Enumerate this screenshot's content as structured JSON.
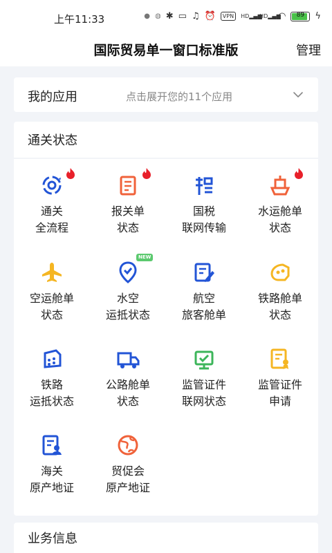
{
  "status_bar": {
    "time": "上午11:33",
    "vpn": "VPN",
    "network_1": "HD",
    "network_2": "HD",
    "battery": 89
  },
  "header": {
    "title": "国际贸易单一窗口标准版",
    "manage": "管理"
  },
  "my_apps": {
    "title": "我的应用",
    "hint": "点击展开您的11个应用"
  },
  "customs_status": {
    "title": "通关状态",
    "badge_new": "NEW",
    "items": [
      {
        "line1": "通关",
        "line2": "全流程",
        "icon": "clearance-cycle-icon",
        "color": "#2254d6",
        "badge": "fire"
      },
      {
        "line1": "报关单",
        "line2": "状态",
        "icon": "declaration-doc-icon",
        "color": "#f0623a",
        "badge": "fire"
      },
      {
        "line1": "国税",
        "line2": "联网传输",
        "icon": "tax-icon",
        "color": "#2254d6",
        "badge": ""
      },
      {
        "line1": "水运舱单",
        "line2": "状态",
        "icon": "ship-icon",
        "color": "#f0623a",
        "badge": "fire"
      },
      {
        "line1": "空运舱单",
        "line2": "状态",
        "icon": "airplane-icon",
        "color": "#f5b623",
        "badge": ""
      },
      {
        "line1": "水空",
        "line2": "运抵状态",
        "icon": "location-check-icon",
        "color": "#2254d6",
        "badge": "new"
      },
      {
        "line1": "航空",
        "line2": "旅客舱单",
        "icon": "edit-doc-icon",
        "color": "#2254d6",
        "badge": ""
      },
      {
        "line1": "铁路舱单",
        "line2": "状态",
        "icon": "train-icon",
        "color": "#f5b623",
        "badge": ""
      },
      {
        "line1": "铁路",
        "line2": "运抵状态",
        "icon": "rail-box-icon",
        "color": "#2254d6",
        "badge": ""
      },
      {
        "line1": "公路舱单",
        "line2": "状态",
        "icon": "truck-icon",
        "color": "#2254d6",
        "badge": ""
      },
      {
        "line1": "监管证件",
        "line2": "联网状态",
        "icon": "certificate-network-icon",
        "color": "#3cb55a",
        "badge": ""
      },
      {
        "line1": "监管证件",
        "line2": "申请",
        "icon": "certificate-award-icon",
        "color": "#f5b623",
        "badge": ""
      },
      {
        "line1": "海关",
        "line2": "原产地证",
        "icon": "origin-cert-icon",
        "color": "#2254d6",
        "badge": ""
      },
      {
        "line1": "贸促会",
        "line2": "原产地证",
        "icon": "globe-icon",
        "color": "#f0623a",
        "badge": ""
      }
    ]
  },
  "business_info": {
    "title": "业务信息"
  }
}
